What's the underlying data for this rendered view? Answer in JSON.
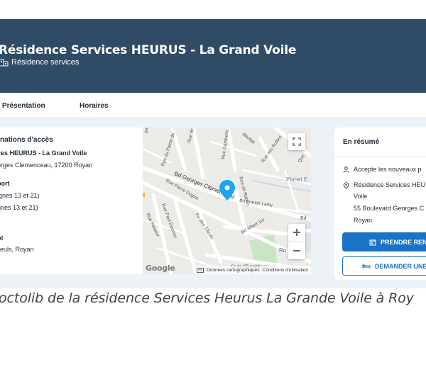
{
  "header": {
    "title": "Résidence Services HEURUS - La Grand Voile",
    "subtitle": "Résidence services",
    "bg_color": "#2f4b66"
  },
  "tabs": [
    {
      "label": "Présentation"
    },
    {
      "label": "Horaires"
    }
  ],
  "access": {
    "title": "nations d'accès",
    "lines": [
      "ces HEURUS - La Grand Voile",
      "orges Clemenceau, 17200 Royan",
      "port",
      "ignes 13 et 21)",
      "gnes 13 et 21)",
      "ot",
      "lleuls, Royan"
    ]
  },
  "map": {
    "streets": {
      "rue_pierre_de": "Rue du Pierre de",
      "rue_de_foch": "Rue de Foch",
      "rue_gambetta": "Rue Gambetta",
      "rue_rullies": "Rue des Rullies",
      "que": "Que",
      "bd_georges_clemenceau": "Bd Georges Clemenceau",
      "rue_pierre_dugua": "Rue Pierre Dugua",
      "rue_de_rabon": "Rue de Rabon",
      "planet_e": "Planet E",
      "bd_franck_lamy": "Bd Franck Lamy",
      "rue_paul_doumer": "Rue Paul Doumer",
      "av_des_tilleuls": "Av. des Tilleuls",
      "rue_pasteur": "Rue Pasteur",
      "bd_albert_1er": "Bd Albert 1er",
      "bd": "Bd",
      "ro": "Ro",
      "publique": "publique",
      "cr_de_leurope": "Cr de l'Europe",
      "dienfait": "dienfait"
    },
    "logo": "Google",
    "footer_data": "Données cartographiques",
    "footer_terms": "Conditions d'utilisation",
    "pin_color": "#1aa6f0"
  },
  "summary": {
    "title": "En résumé",
    "accept": "Accepte les nouveaux p",
    "name_line1": "Résidence Services HEU",
    "name_line2": "Voile",
    "addr_line1": "55 Boulevard Georges C",
    "addr_line2": "Royan",
    "btn_primary": "PRENDRE REN",
    "btn_secondary": "DEMANDER UNE",
    "accent": "#1a73c5"
  },
  "caption": "octolib de la résidence Services Heurus La Grande Voile à Roy"
}
